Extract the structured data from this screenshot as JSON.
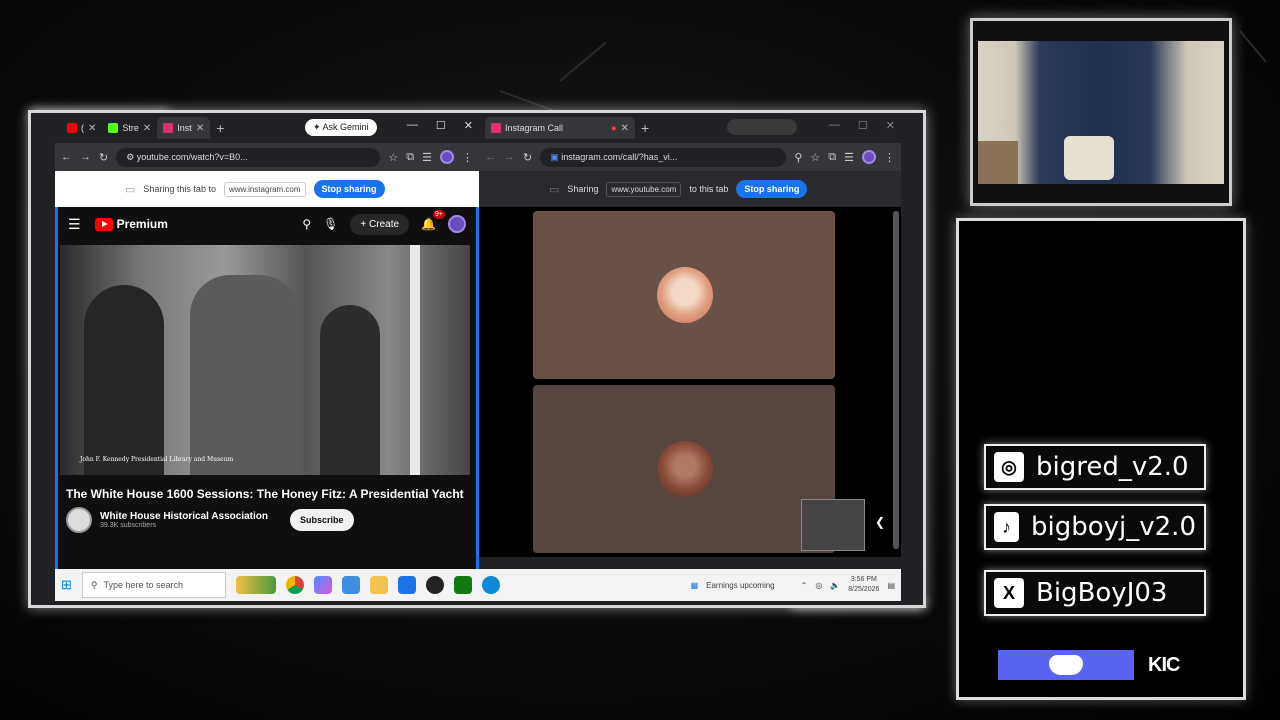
{
  "left_browser": {
    "tabs": [
      {
        "label": "(",
        "icon": "youtube-icon",
        "color": "#ff0000"
      },
      {
        "label": "Stre",
        "icon": "kick-icon",
        "color": "#53fc18"
      },
      {
        "label": "Inst",
        "icon": "instagram-icon",
        "color": "#e1306c"
      }
    ],
    "gemini_label": "Ask Gemini",
    "url": "youtube.com/watch?v=B0...",
    "share_text": "Sharing this tab to",
    "share_domain": "www.instagram.com",
    "stop_label": "Stop sharing"
  },
  "youtube": {
    "logo_text": "Premium",
    "create_label": "Create",
    "notif_count": "9+",
    "video_credit": "John F. Kennedy Presidential Library and Museum",
    "title": "The White House 1600 Sessions: The Honey Fitz: A Presidential Yacht",
    "channel_name": "White House Historical Association",
    "channel_subs": "39.3K subscribers",
    "subscribe_label": "Subscribe"
  },
  "right_browser": {
    "tab_label": "Instagram Call",
    "url": "instagram.com/call/?has_vi...",
    "share_text": "Sharing",
    "share_domain": "www.youtube.com",
    "share_text2": "to this tab",
    "stop_label": "Stop sharing"
  },
  "taskbar": {
    "search_placeholder": "Type here to search",
    "widget_label": "Earnings upcoming",
    "time": "3:56 PM",
    "date": "8/25/2026"
  },
  "socials": {
    "instagram": "bigred_v2.0",
    "tiktok": "bigboyj_v2.0",
    "x": "BigBoyJ03",
    "kick": "KIC"
  },
  "colors": {
    "accent_blue": "#1a73e8",
    "youtube_red": "#ff0000",
    "discord": "#5865f2"
  }
}
